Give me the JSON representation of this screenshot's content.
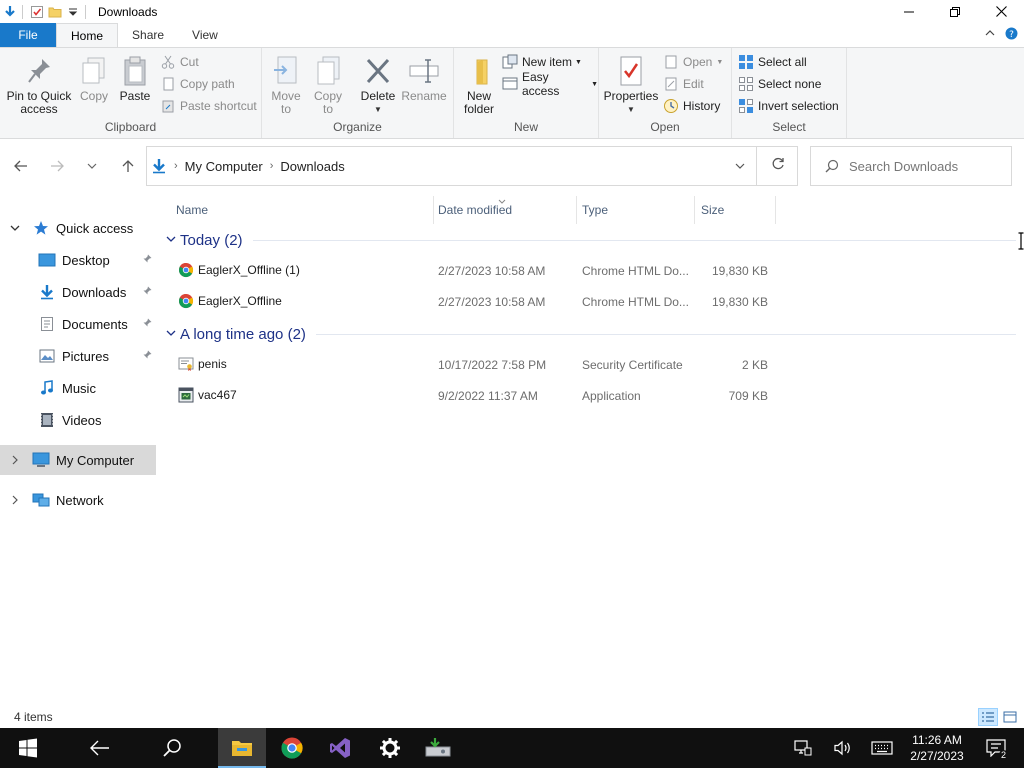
{
  "window": {
    "title": "Downloads"
  },
  "ribbon_tabs": {
    "file": "File",
    "home": "Home",
    "share": "Share",
    "view": "View"
  },
  "ribbon": {
    "clipboard": {
      "pin": "Pin to Quick access",
      "copy": "Copy",
      "paste": "Paste",
      "cut": "Cut",
      "copy_path": "Copy path",
      "paste_shortcut": "Paste shortcut",
      "label": "Clipboard"
    },
    "organize": {
      "move_to": "Move to",
      "copy_to": "Copy to",
      "delete": "Delete",
      "rename": "Rename",
      "label": "Organize"
    },
    "new": {
      "new_folder": "New folder",
      "new_item": "New item",
      "easy_access": "Easy access",
      "label": "New"
    },
    "open": {
      "properties": "Properties",
      "open": "Open",
      "edit": "Edit",
      "history": "History",
      "label": "Open"
    },
    "select": {
      "select_all": "Select all",
      "select_none": "Select none",
      "invert_selection": "Invert selection",
      "label": "Select"
    }
  },
  "address": {
    "crumbs": [
      "My Computer",
      "Downloads"
    ],
    "search_placeholder": "Search Downloads"
  },
  "nav": {
    "quick_access": "Quick access",
    "items": [
      {
        "label": "Desktop",
        "icon": "desktop-folder-icon",
        "pinned": true
      },
      {
        "label": "Downloads",
        "icon": "downloads-folder-icon",
        "pinned": true
      },
      {
        "label": "Documents",
        "icon": "documents-folder-icon",
        "pinned": true
      },
      {
        "label": "Pictures",
        "icon": "pictures-folder-icon",
        "pinned": true
      },
      {
        "label": "Music",
        "icon": "music-folder-icon",
        "pinned": false
      },
      {
        "label": "Videos",
        "icon": "videos-folder-icon",
        "pinned": false
      }
    ],
    "my_computer": "My Computer",
    "network": "Network"
  },
  "columns": {
    "name": "Name",
    "date_modified": "Date modified",
    "type": "Type",
    "size": "Size"
  },
  "groups": [
    {
      "title": "Today (2)",
      "files": [
        {
          "name": "EaglerX_Offline (1)",
          "date": "2/27/2023 10:58 AM",
          "type": "Chrome HTML Do...",
          "size": "19,830 KB",
          "icon": "chrome-html-icon"
        },
        {
          "name": "EaglerX_Offline",
          "date": "2/27/2023 10:58 AM",
          "type": "Chrome HTML Do...",
          "size": "19,830 KB",
          "icon": "chrome-html-icon"
        }
      ]
    },
    {
      "title": "A long time ago (2)",
      "files": [
        {
          "name": "penis",
          "date": "10/17/2022 7:58 PM",
          "type": "Security Certificate",
          "size": "2 KB",
          "icon": "certificate-icon"
        },
        {
          "name": "vac467",
          "date": "9/2/2022 11:37 AM",
          "type": "Application",
          "size": "709 KB",
          "icon": "application-icon"
        }
      ]
    }
  ],
  "status": {
    "item_count": "4 items"
  },
  "taskbar": {
    "time": "11:26 AM",
    "date": "2/27/2023",
    "notification_count": "2"
  },
  "colors": {
    "file_tab": "#1979ca",
    "group_header": "#1e3287",
    "taskbar": "#101010",
    "nav_selected": "#d9d9d9"
  }
}
